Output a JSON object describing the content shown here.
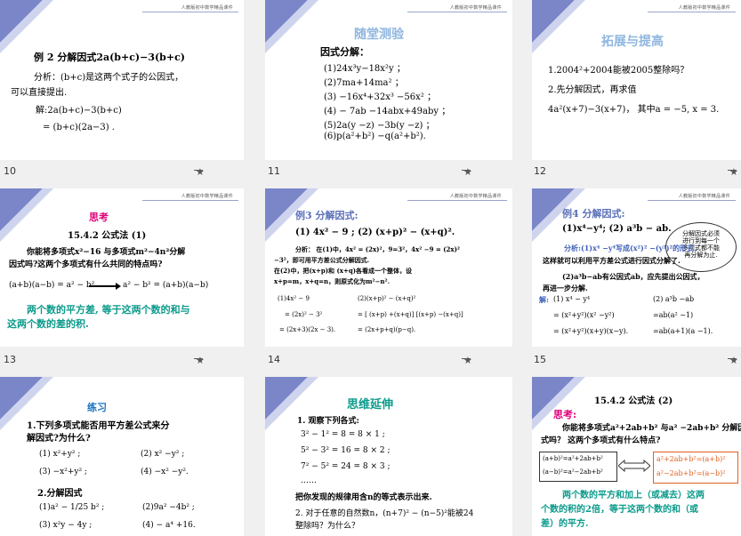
{
  "banner_text": "人教版初中数学精品课件",
  "slides": {
    "s10": {
      "number": "10",
      "lines": [
        "例 2  分解因式2a(b+c)−3(b+c)",
        "分析：(b+c)是这两个式子的公因式，",
        "可以直接提出.",
        "解:2a(b+c)−3(b+c)",
        "= (b+c)(2a−3) ."
      ]
    },
    "s11": {
      "number": "11",
      "title": "随堂测验",
      "subtitle": "因式分解：",
      "items": [
        "(1)24x³y−18x²y ；",
        "(2)7ma+14ma² ；",
        "(3) −16x⁴+32x³ −56x² ；",
        "(4) − 7ab −14abx+49aby ；",
        "(5)2a(y −z) −3b(y −z) ；",
        "(6)p(a²+b²) −q(a²+b²)."
      ]
    },
    "s12": {
      "number": "12",
      "title": "拓展与提高",
      "items": [
        "1.2004²+2004能被2005整除吗？",
        "2.先分解因式，再求值",
        "4a²(x+7)−3(x+7)， 其中a = −5, x = 3."
      ]
    },
    "s13": {
      "number": "13",
      "heading": "思考",
      "section": "15.4.2    公式法 (1)",
      "question1": "你能将多项式x²−16 与多项式m²−4n²分解",
      "question2": "因式吗?这两个多项式有什么共同的特点吗?",
      "formula_left": "(a+b)(a−b) = a² − b²",
      "formula_right": "a² − b² = (a+b)(a−b)",
      "conclusion1": "两个数的平方差, 等于这两个数的和与",
      "conclusion2": "这两个数的差的积."
    },
    "s14": {
      "number": "14",
      "title1": "例3  分解因式:",
      "title2": "(1) 4x² − 9 ;      (2) (x+p)² − (x+q)².",
      "analysis": [
        "分析：  在(1)中，4x² = (2x)²，9=3²，4x² −9 = (2x)²",
        "−3²，即可用平方差公式分解因式.",
        "    在(2)中，把(x+p)和 (x+q)各看成一个整体，设",
        "x+p=m，x+q=n，则原式化为m²−n²."
      ],
      "solution_left": [
        "(1)4x² − 9",
        "= (2x)² − 3²",
        "= (2x+3)(2x − 3)."
      ],
      "solution_right": [
        "(2)(x+p)² − (x+q)²",
        "= [ (x+p) +(x+q)] [(x+p) −(x+q)]",
        "= (2x+p+q)(p−q)."
      ]
    },
    "s15": {
      "number": "15",
      "title": "例4  分解因式:",
      "problems": "(1)x⁴−y⁴;        (2) a³b − ab.",
      "cloud_text": [
        "分解因式必须",
        "进行到每一个",
        "多项式都不能",
        "再分解为止."
      ],
      "analysis": [
        "分析:(1)x⁴ −y⁴写成(x²)² −(y²)²的形式，",
        "这样就可以利用平方差公式进行因式分解了.",
        "(2)a³b−ab有公因式ab，应先提出公因式，",
        "再进一步分解."
      ],
      "sol_label": "解:",
      "solution_left": [
        "(1) x⁴ − y⁴",
        "= (x²+y²)(x² −y²)",
        "= (x²+y²)(x+y)(x−y)."
      ],
      "solution_right": [
        "(2) a³b −ab",
        "=ab(a² −1)",
        "=ab(a+1)(a −1)."
      ]
    },
    "s16": {
      "title": "练习",
      "q1": "1.下列多项式能否用平方差公式来分",
      "q1b": "解因式?为什么?",
      "opts": [
        "(1)  x²+y² ;",
        "(2)  x² −y² ;",
        "(3)  −x²+y² ;",
        "(4)  −x² −y²."
      ],
      "q2": "2.分解因式",
      "opts2": [
        "(1)a² − 1/25 b² ;",
        "(2)9a² −4b² ;",
        "(3) x²y − 4y ;",
        "(4)  − a⁴ +16."
      ]
    },
    "s17": {
      "title": "思维延伸",
      "q1": "1. 观察下列各式:",
      "eqs": [
        "3² − 1² = 8 = 8 × 1 ;",
        "5² − 3² = 16 = 8 × 2 ;",
        "7² − 5² = 24 = 8 × 3 ;",
        "……"
      ],
      "summary": "把你发现的规律用含n的等式表示出来.",
      "q2": "2. 对于任意的自然数n，(n+7)² − (n−5)²能被24",
      "q2b": "整除吗？为什么？"
    },
    "s18": {
      "section": "15.4.2      公式法 (2)",
      "heading": "思考:",
      "question1": "你能将多项式a²+2ab+b² 与a² −2ab+b² 分解因",
      "question2": "式吗？ 这两个多项式有什么特点?",
      "left_box": [
        "(a+b)²=a²+2ab+b²",
        "(a−b)²=a²−2ab+b²"
      ],
      "right_box": [
        "a²+2ab+b²=(a+b)²",
        "a²−2ab+b²=(a−b)²"
      ],
      "conclusion": [
        "两个数的平方和加上（或减去）这两",
        "个数的积的2倍，等于这两个数的和（或",
        "差）的平方."
      ]
    }
  }
}
